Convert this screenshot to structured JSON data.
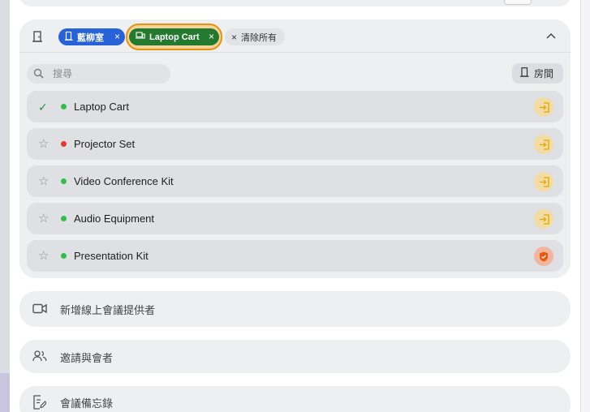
{
  "header": {
    "room_chip_label": "藍柳室",
    "laptop_chip_label": "Laptop Cart",
    "clear_all_label": "清除所有"
  },
  "filter": {
    "search_placeholder": "搜尋",
    "room_button_label": "房間"
  },
  "resources": [
    {
      "name": "Laptop Cart",
      "selected": true,
      "status": "available",
      "action": "join-icon"
    },
    {
      "name": "Projector Set",
      "selected": false,
      "status": "busy",
      "action": "join-icon"
    },
    {
      "name": "Video Conference Kit",
      "selected": false,
      "status": "available",
      "action": "join-icon"
    },
    {
      "name": "Audio Equipment",
      "selected": false,
      "status": "available",
      "action": "join-icon"
    },
    {
      "name": "Presentation Kit",
      "selected": false,
      "status": "available",
      "action": "shield-icon"
    }
  ],
  "sections": {
    "online_meeting": "新增線上會議提供者",
    "invite": "邀請與會者",
    "notes": "會議備忘錄"
  },
  "colors": {
    "room_chip": "#2762d9",
    "laptop_chip": "#237a2e",
    "focus_ring": "#e8920c",
    "available": "#2fbf4a",
    "busy": "#e53935",
    "join_icon": "#e0a800",
    "shield_icon": "#e8590c"
  }
}
